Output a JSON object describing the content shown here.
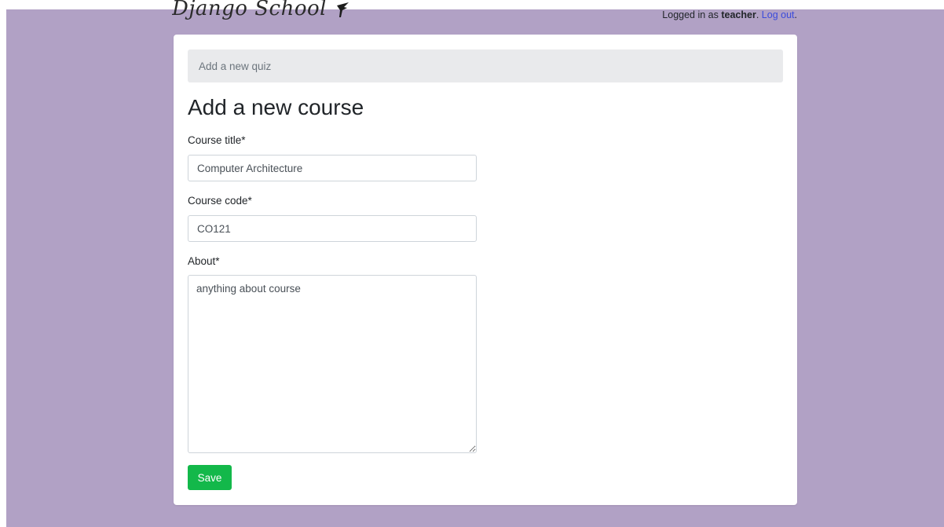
{
  "header": {
    "brand_text": "Django School",
    "user_status": {
      "prefix": "Logged in as ",
      "username": "teacher",
      "separator": ". ",
      "logout_label": "Log out",
      "suffix": "."
    }
  },
  "breadcrumb": {
    "label": "Add a new quiz"
  },
  "form": {
    "title": "Add a new course",
    "course_title": {
      "label": "Course title*",
      "value": "Computer Architecture"
    },
    "course_code": {
      "label": "Course code*",
      "value": "CO121"
    },
    "about": {
      "label": "About*",
      "value": "anything about course"
    },
    "save_label": "Save"
  },
  "colors": {
    "page_background": "#b1a1c5",
    "card_background": "#ffffff",
    "breadcrumb_background": "#e9eaec",
    "save_button": "#13b84a",
    "link": "#3b4bdb"
  }
}
